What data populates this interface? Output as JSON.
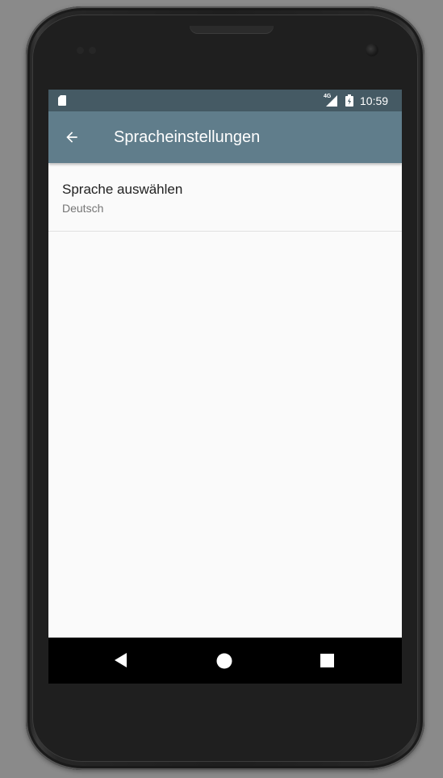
{
  "status_bar": {
    "time": "10:59",
    "network_type": "4G",
    "icons": [
      "sd-card-icon",
      "signal-icon",
      "battery-icon"
    ]
  },
  "toolbar": {
    "title": "Spracheinstellungen",
    "back_icon": "arrow-back-icon"
  },
  "preferences": [
    {
      "title": "Sprache auswählen",
      "summary": "Deutsch"
    }
  ],
  "nav_bar": {
    "icons": [
      "nav-back-icon",
      "nav-home-icon",
      "nav-recents-icon"
    ]
  },
  "colors": {
    "status_bar": "#455a64",
    "toolbar": "#607d8b",
    "background": "#fafafa",
    "title_text": "#212121",
    "summary_text": "#757575"
  }
}
